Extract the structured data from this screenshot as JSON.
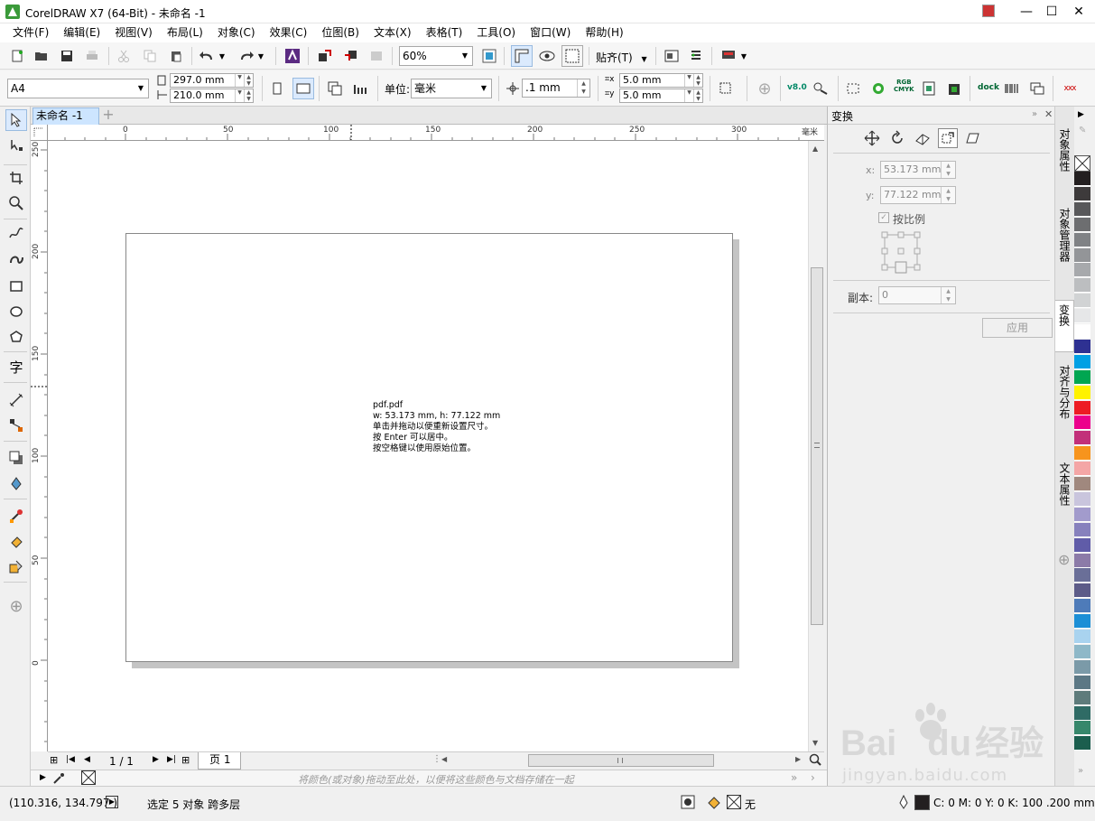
{
  "window": {
    "title": "CorelDRAW X7 (64-Bit) - 未命名 -1",
    "minimize": "—",
    "maximize": "☐",
    "close": "✕"
  },
  "menu": [
    "文件(F)",
    "编辑(E)",
    "视图(V)",
    "布局(L)",
    "对象(C)",
    "效果(C)",
    "位图(B)",
    "文本(X)",
    "表格(T)",
    "工具(O)",
    "窗口(W)",
    "帮助(H)"
  ],
  "toolbar1": {
    "zoom": "60%",
    "snap": "贴齐(T)"
  },
  "property_bar": {
    "page_size": "A4",
    "width": "297.0 mm",
    "height": "210.0 mm",
    "units_label": "单位:",
    "units": "毫米",
    "nudge": ".1 mm",
    "dup_x": "5.0 mm",
    "dup_y": "5.0 mm",
    "version_badge": "v8.0",
    "rgb_label": "RGB",
    "cmyk_label": "CMYK",
    "dock_label": "dock"
  },
  "document": {
    "tab": "未命名 -1"
  },
  "ruler": {
    "top": [
      "0",
      "50",
      "100",
      "150",
      "200",
      "250",
      "300"
    ],
    "unit": "毫米",
    "left": [
      "250",
      "200",
      "150",
      "100",
      "50",
      "0"
    ]
  },
  "tooltip": {
    "lines": [
      "pdf.pdf",
      "w: 53.173 mm, h: 77.122 mm",
      "单击并拖动以便重新设置尺寸。",
      "按 Enter 可以居中。",
      "按空格键以使用原始位置。"
    ]
  },
  "page_nav": {
    "current": "1 / 1",
    "page_tab": "页 1"
  },
  "doc_palette": {
    "hint": "将颜色(或对象)拖动至此处，以便将这些颜色与文档存储在一起"
  },
  "docker": {
    "title": "变换",
    "x_label": "x:",
    "x_value": "53.173 mm",
    "y_label": "y:",
    "y_value": "77.122 mm",
    "proportional": "按比例",
    "copies_label": "副本:",
    "copies_value": "0",
    "apply": "应用"
  },
  "side_tabs": [
    "对象属性",
    "对象管理器",
    "变换",
    "对齐与分布",
    "文本属性"
  ],
  "palette_colors": [
    "#231f20",
    "#3d3a3b",
    "#58585a",
    "#6d6e70",
    "#808285",
    "#939598",
    "#a7a9ac",
    "#bcbec0",
    "#d1d3d4",
    "#e6e7e8",
    "#ffffff",
    "#2e3192",
    "#00a0e4",
    "#00a651",
    "#fff200",
    "#ed1c24",
    "#ec008c",
    "#c2307a",
    "#f7941d",
    "#f4a6a6",
    "#a0887e",
    "#c9c5dd",
    "#a29bcc",
    "#8781bd",
    "#605ca8",
    "#8c7ba8",
    "#6a6f98",
    "#5c5b88",
    "#4e7bb9",
    "#1c8fd6",
    "#a9d3ef",
    "#8eb8c8",
    "#7b9aa8",
    "#5c7885",
    "#5e7b7b",
    "#2f6b65",
    "#37876b",
    "#1b5e4e"
  ],
  "status": {
    "coords": "(110.316, 134.797 )",
    "selection": "选定 5 对象 跨多层",
    "fill": "无",
    "outline": "C: 0 M: 0 Y: 0 K: 100  .200 mm"
  },
  "watermark": {
    "brand": "Bai",
    "brand2": "du",
    "cn": "经验",
    "url": "jingyan.baidu.com"
  }
}
